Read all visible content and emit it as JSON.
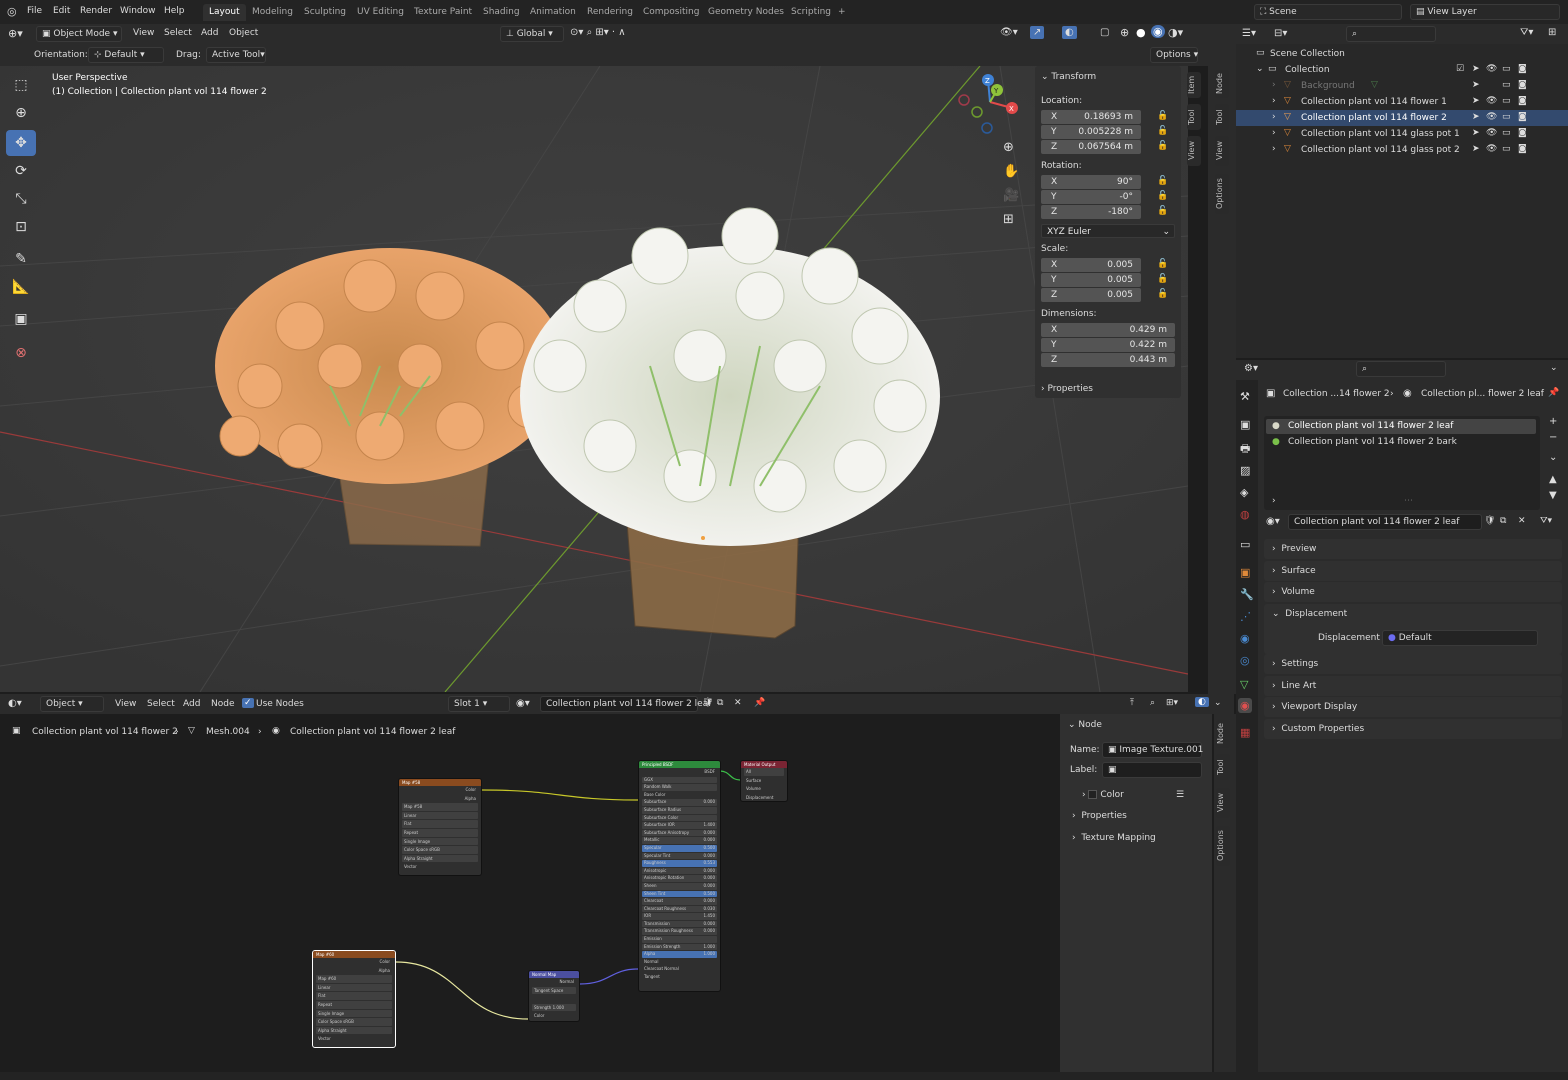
{
  "menubar": {
    "items": [
      "File",
      "Edit",
      "Render",
      "Window",
      "Help"
    ]
  },
  "workspaces": {
    "tabs": [
      "Layout",
      "Modeling",
      "Sculpting",
      "UV Editing",
      "Texture Paint",
      "Shading",
      "Animation",
      "Rendering",
      "Compositing",
      "Geometry Nodes",
      "Scripting",
      "+"
    ]
  },
  "scene": {
    "label": "Scene",
    "view_layer": "View Layer"
  },
  "viewport_header": {
    "mode": "Object Mode",
    "view": "View",
    "select": "Select",
    "add": "Add",
    "object": "Object",
    "transform_orientation": "Global",
    "orientation_label": "Orientation:",
    "orientation_value": "Default",
    "drag_label": "Drag:",
    "drag_value": "Active Tool",
    "options": "Options"
  },
  "viewport": {
    "perspective": "User Perspective",
    "collection_info": "(1) Collection | Collection plant vol 114 flower 2"
  },
  "gizmo": {
    "x": "X",
    "y": "Y",
    "z": "Z"
  },
  "npanel": {
    "transform_title": "Transform",
    "location_label": "Location:",
    "location": [
      {
        "axis": "X",
        "value": "0.18693 m"
      },
      {
        "axis": "Y",
        "value": "0.005228 m"
      },
      {
        "axis": "Z",
        "value": "0.067564 m"
      }
    ],
    "rotation_label": "Rotation:",
    "rotation": [
      {
        "axis": "X",
        "value": "90°"
      },
      {
        "axis": "Y",
        "value": "-0°"
      },
      {
        "axis": "Z",
        "value": "-180°"
      }
    ],
    "rotation_mode": "XYZ Euler",
    "scale_label": "Scale:",
    "scale": [
      {
        "axis": "X",
        "value": "0.005"
      },
      {
        "axis": "Y",
        "value": "0.005"
      },
      {
        "axis": "Z",
        "value": "0.005"
      }
    ],
    "dimensions_label": "Dimensions:",
    "dimensions": [
      {
        "axis": "X",
        "value": "0.429 m"
      },
      {
        "axis": "Y",
        "value": "0.422 m"
      },
      {
        "axis": "Z",
        "value": "0.443 m"
      }
    ],
    "properties": "Properties",
    "tabs": [
      "Item",
      "Tool",
      "View"
    ]
  },
  "right_tabs_top": [
    "Node",
    "Tool",
    "View",
    "Options"
  ],
  "outliner": {
    "scene_collection": "Scene Collection",
    "collection": "Collection",
    "items": [
      "Background",
      "Collection plant vol 114 flower 1",
      "Collection plant vol 114 flower 2",
      "Collection plant vol 114 glass pot 1",
      "Collection plant vol 114 glass pot 2"
    ]
  },
  "properties": {
    "breadcrumb_1": "Collection ...14 flower 2",
    "breadcrumb_2": "Collection pl... flower 2 leaf",
    "slots": [
      "Collection plant vol 114 flower 2 leaf",
      "Collection plant vol 114 flower 2 bark"
    ],
    "material_name": "Collection plant vol 114 flower 2 leaf",
    "panels": [
      "Preview",
      "Surface",
      "Volume",
      "Displacement",
      "Settings",
      "Line Art",
      "Viewport Display",
      "Custom Properties"
    ],
    "displacement_label": "Displacement",
    "displacement_value": "Default"
  },
  "node_header": {
    "object": "Object",
    "view": "View",
    "select": "Select",
    "add": "Add",
    "node": "Node",
    "use_nodes": "Use Nodes",
    "slot": "Slot 1",
    "material": "Collection plant vol 114 flower 2 leaf"
  },
  "node_breadcrumb": {
    "object": "Collection plant vol 114 flower 2",
    "mesh": "Mesh.004",
    "material": "Collection plant vol 114 flower 2 leaf"
  },
  "node_sidebar": {
    "node_title": "Node",
    "name_label": "Name:",
    "name_value": "Image Texture.001",
    "label_label": "Label:",
    "color": "Color",
    "properties": "Properties",
    "texture_mapping": "Texture Mapping",
    "tabs": [
      "Node",
      "Tool",
      "View",
      "Options"
    ]
  },
  "nodes": {
    "tex1": {
      "title": "Map #58",
      "out1": "Color",
      "out2": "Alpha",
      "rows": [
        "Map #58",
        "Linear",
        "Flat",
        "Repeat",
        "Single Image",
        "Color Space   sRGB",
        "Alpha   Straight",
        "Vector"
      ]
    },
    "tex2": {
      "title": "Map #60",
      "out1": "Color",
      "out2": "Alpha",
      "rows": [
        "Map #60",
        "Linear",
        "Flat",
        "Repeat",
        "Single Image",
        "Color Space   sRGB",
        "Alpha   Straight",
        "Vector"
      ]
    },
    "normal": {
      "title": "Normal Map",
      "out": "Normal",
      "rows": [
        "Tangent Space",
        "",
        "Strength   1.000",
        "Color"
      ]
    },
    "bsdf": {
      "title": "Principled BSDF",
      "out": "BSDF",
      "rows": [
        [
          "GGX",
          ""
        ],
        [
          "Random Walk",
          ""
        ],
        [
          "Base Color",
          ""
        ],
        [
          "Subsurface",
          "0.000"
        ],
        [
          "Subsurface Radius",
          ""
        ],
        [
          "Subsurface Color",
          ""
        ],
        [
          "Subsurface IOR",
          "1.400"
        ],
        [
          "Subsurface Anisotropy",
          "0.000"
        ],
        [
          "Metallic",
          "0.000"
        ],
        [
          "Specular",
          "0.500"
        ],
        [
          "Specular Tint",
          "0.000"
        ],
        [
          "Roughness",
          "0.553"
        ],
        [
          "Anisotropic",
          "0.000"
        ],
        [
          "Anisotropic Rotation",
          "0.000"
        ],
        [
          "Sheen",
          "0.000"
        ],
        [
          "Sheen Tint",
          "0.500"
        ],
        [
          "Clearcoat",
          "0.000"
        ],
        [
          "Clearcoat Roughness",
          "0.030"
        ],
        [
          "IOR",
          "1.450"
        ],
        [
          "Transmission",
          "0.000"
        ],
        [
          "Transmission Roughness",
          "0.000"
        ],
        [
          "Emission",
          ""
        ],
        [
          "Emission Strength",
          "1.000"
        ],
        [
          "Alpha",
          "1.000"
        ],
        [
          "Normal",
          ""
        ],
        [
          "Clearcoat Normal",
          ""
        ],
        [
          "Tangent",
          ""
        ]
      ]
    },
    "output": {
      "title": "Material Output",
      "sel": "All",
      "rows": [
        "Surface",
        "Volume",
        "Displacement"
      ]
    }
  },
  "colors": {
    "accent": "#4772b3",
    "header_bg": "#2b2b2b",
    "viewport_bg": "#3b3b3b",
    "x_axis": "#e24a4a",
    "y_axis": "#8fc33a",
    "z_axis": "#3f82d6",
    "tex_header": "#8a4b1f",
    "bsdf_header": "#2d8a3c",
    "output_header": "#7a2433",
    "normal_header": "#4b4fa0"
  }
}
